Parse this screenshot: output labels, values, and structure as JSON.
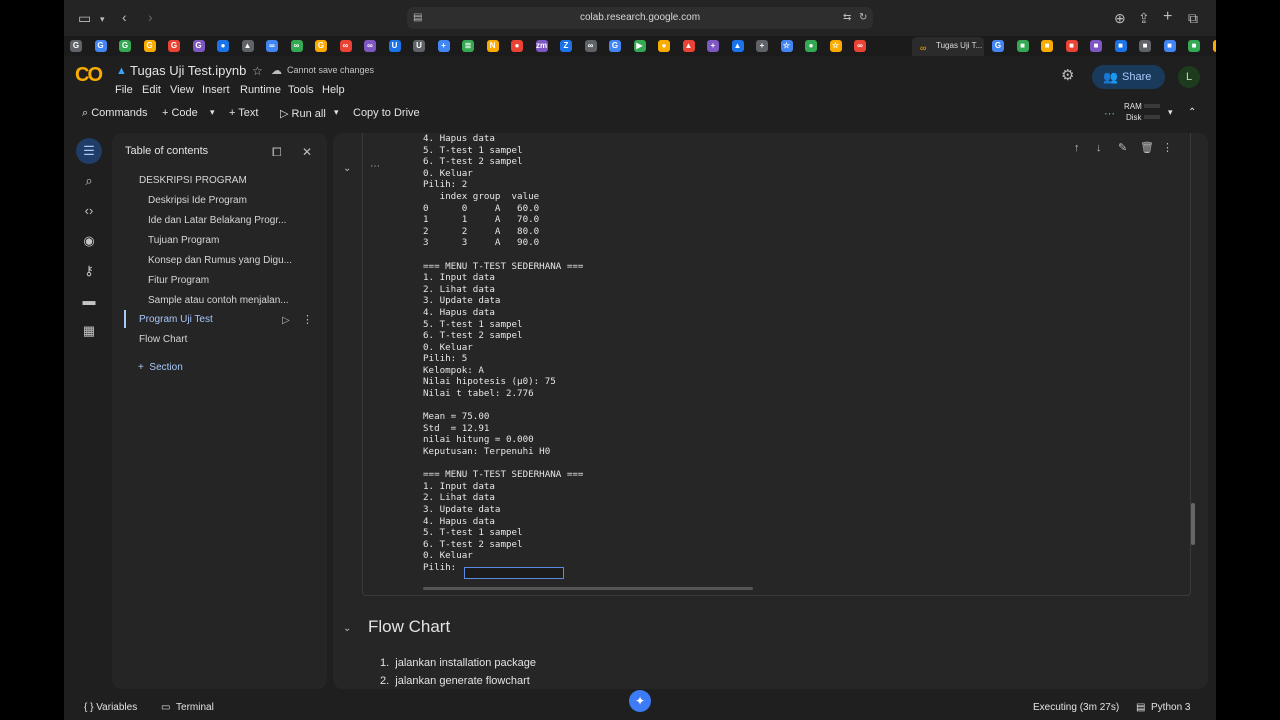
{
  "browser": {
    "url": "colab.research.google.com",
    "active_tab_title": "Tugas Uji T...",
    "favicons": [
      "G",
      "G",
      "G",
      "G",
      "G",
      "G",
      "●",
      "▲",
      "∞",
      "∞",
      "G",
      "∞",
      "∞",
      "U",
      "U",
      "+",
      "≣",
      "N",
      "●",
      "zm",
      "Z",
      "∞",
      "G",
      "▶",
      "●",
      "▲",
      "+",
      "▲",
      "+",
      "☆",
      "●",
      "☆",
      "∞"
    ],
    "favicons_right": [
      "G",
      "■",
      "■",
      "■",
      "■",
      "■",
      "■",
      "■",
      "■",
      "■"
    ]
  },
  "colab": {
    "logo": "CO",
    "notebook_title": "Tugas Uji Test.ipynb",
    "cannot_save": "Cannot save changes",
    "menu": [
      "File",
      "Edit",
      "View",
      "Insert",
      "Runtime",
      "Tools",
      "Help"
    ],
    "share_label": "Share",
    "avatar_letter": "L",
    "toolbar": {
      "commands": "Commands",
      "code": "Code",
      "text": "Text",
      "run_all": "Run all",
      "copy_drive": "Copy to Drive",
      "ram": "RAM",
      "disk": "Disk"
    }
  },
  "toc": {
    "title": "Table of contents",
    "items": [
      {
        "label": "DESKRIPSI PROGRAM",
        "level": 1
      },
      {
        "label": "Deskripsi Ide Program",
        "level": 2
      },
      {
        "label": "Ide dan Latar Belakang Progr...",
        "level": 2
      },
      {
        "label": "Tujuan Program",
        "level": 2
      },
      {
        "label": "Konsep dan Rumus yang Digu...",
        "level": 2
      },
      {
        "label": "Fitur Program",
        "level": 2
      },
      {
        "label": "Sample atau contoh menjalan...",
        "level": 2
      },
      {
        "label": "Program Uji Test",
        "level": 1
      },
      {
        "label": "Flow Chart",
        "level": 1
      }
    ],
    "add_section": "Section"
  },
  "output_lines": [
    "4. Hapus data",
    "5. T-test 1 sampel",
    "6. T-test 2 sampel",
    "0. Keluar",
    "Pilih: 2",
    "   index group  value",
    "0      0     A   60.0",
    "1      1     A   70.0",
    "2      2     A   80.0",
    "3      3     A   90.0",
    "",
    "=== MENU T-TEST SEDERHANA ===",
    "1. Input data",
    "2. Lihat data",
    "3. Update data",
    "4. Hapus data",
    "5. T-test 1 sampel",
    "6. T-test 2 sampel",
    "0. Keluar",
    "Pilih: 5",
    "Kelompok: A",
    "Nilai hipotesis (μ0): 75",
    "Nilai t tabel: 2.776",
    "",
    "Mean = 75.00",
    "Std  = 12.91",
    "nilai hitung = 0.000",
    "Keputusan: Terpenuhi H0",
    "",
    "=== MENU T-TEST SEDERHANA ===",
    "1. Input data",
    "2. Lihat data",
    "3. Update data",
    "4. Hapus data",
    "5. T-test 1 sampel",
    "6. T-test 2 sampel",
    "0. Keluar",
    "Pilih: "
  ],
  "input_value": "",
  "flowchart": {
    "heading": "Flow Chart",
    "steps": [
      "jalankan installation package",
      "jalankan generate flowchart"
    ]
  },
  "statusbar": {
    "variables": "Variables",
    "terminal": "Terminal",
    "executing": "Executing (3m 27s)",
    "runtime": "Python 3"
  }
}
